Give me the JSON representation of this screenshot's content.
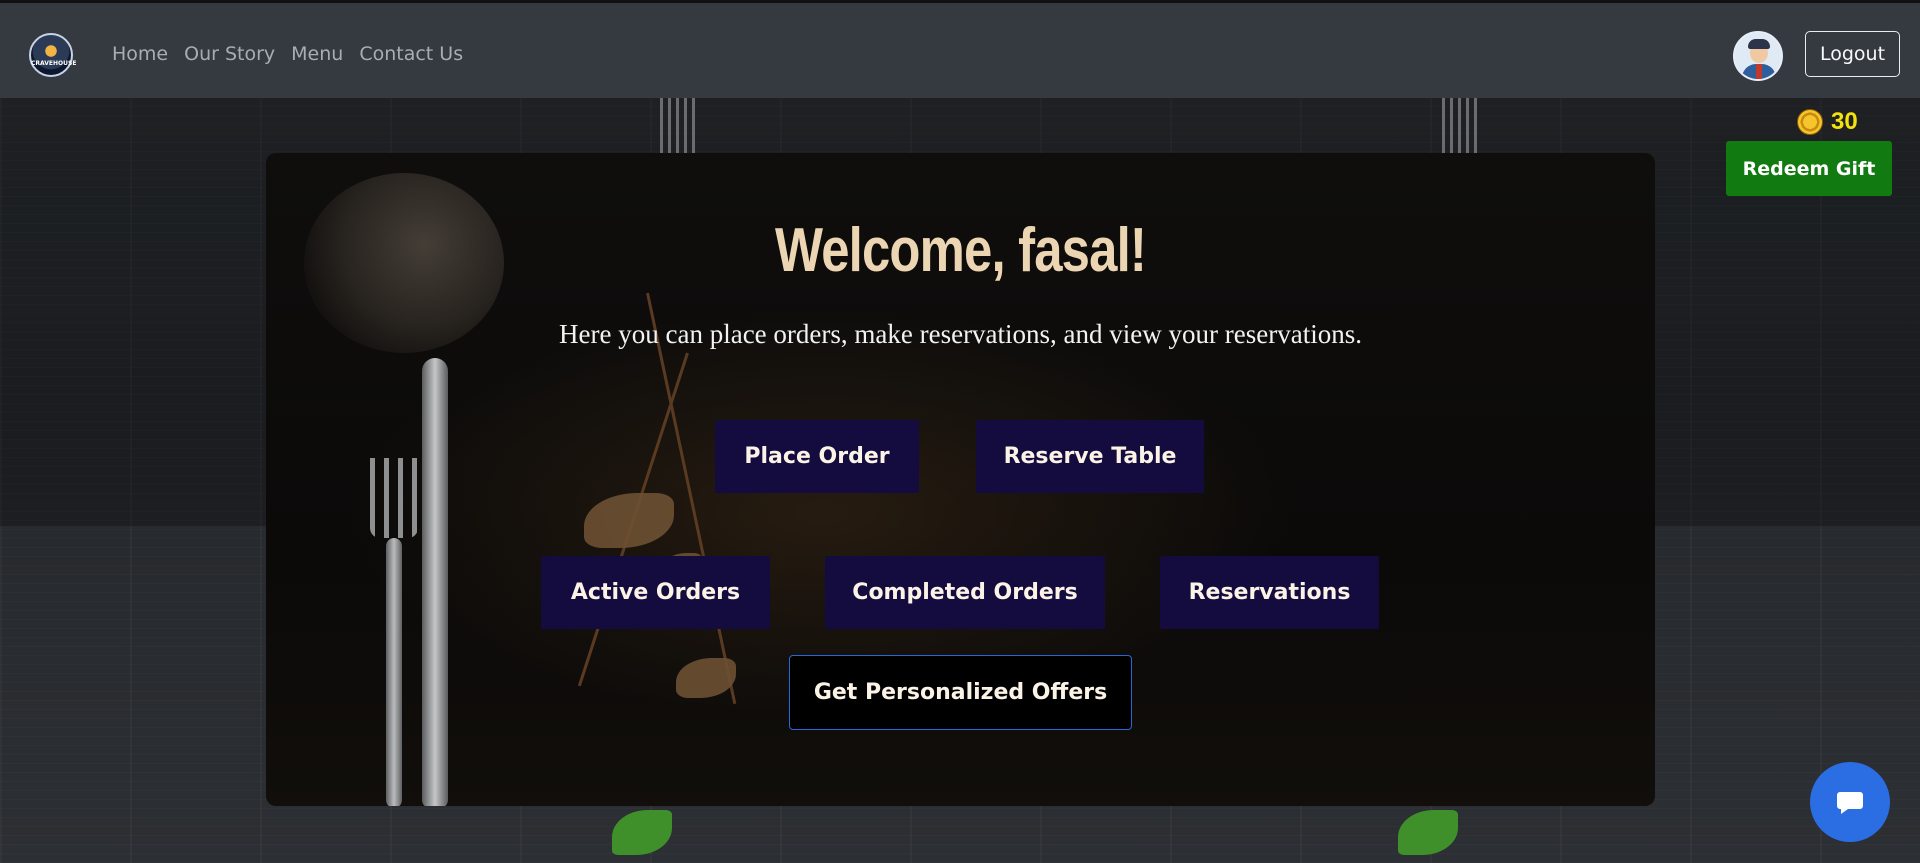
{
  "brand": {
    "logo_text": "CRAVEHOUSE"
  },
  "nav": {
    "links": [
      "Home",
      "Our Story",
      "Menu",
      "Contact Us"
    ],
    "logout_label": "Logout"
  },
  "rewards": {
    "coins": "30",
    "redeem_label": "Redeem Gift"
  },
  "main": {
    "welcome": "Welcome, fasal!",
    "subtitle": "Here you can place orders, make reservations, and view your reservations.",
    "buttons": {
      "place_order": "Place Order",
      "reserve_table": "Reserve Table",
      "active_orders": "Active Orders",
      "completed_orders": "Completed Orders",
      "reservations": "Reservations",
      "personalized_offers": "Get Personalized Offers"
    }
  },
  "colors": {
    "navbar": "#343a40",
    "action_button": "#140b3f",
    "redeem_button": "#117a11",
    "chat_button": "#2b6de3",
    "welcome_text": "#ecd5b2",
    "coin_text": "#f5e20c"
  },
  "icons": {
    "coin": "coin-icon",
    "chat": "chat-bubble-icon",
    "avatar": "user-avatar"
  }
}
